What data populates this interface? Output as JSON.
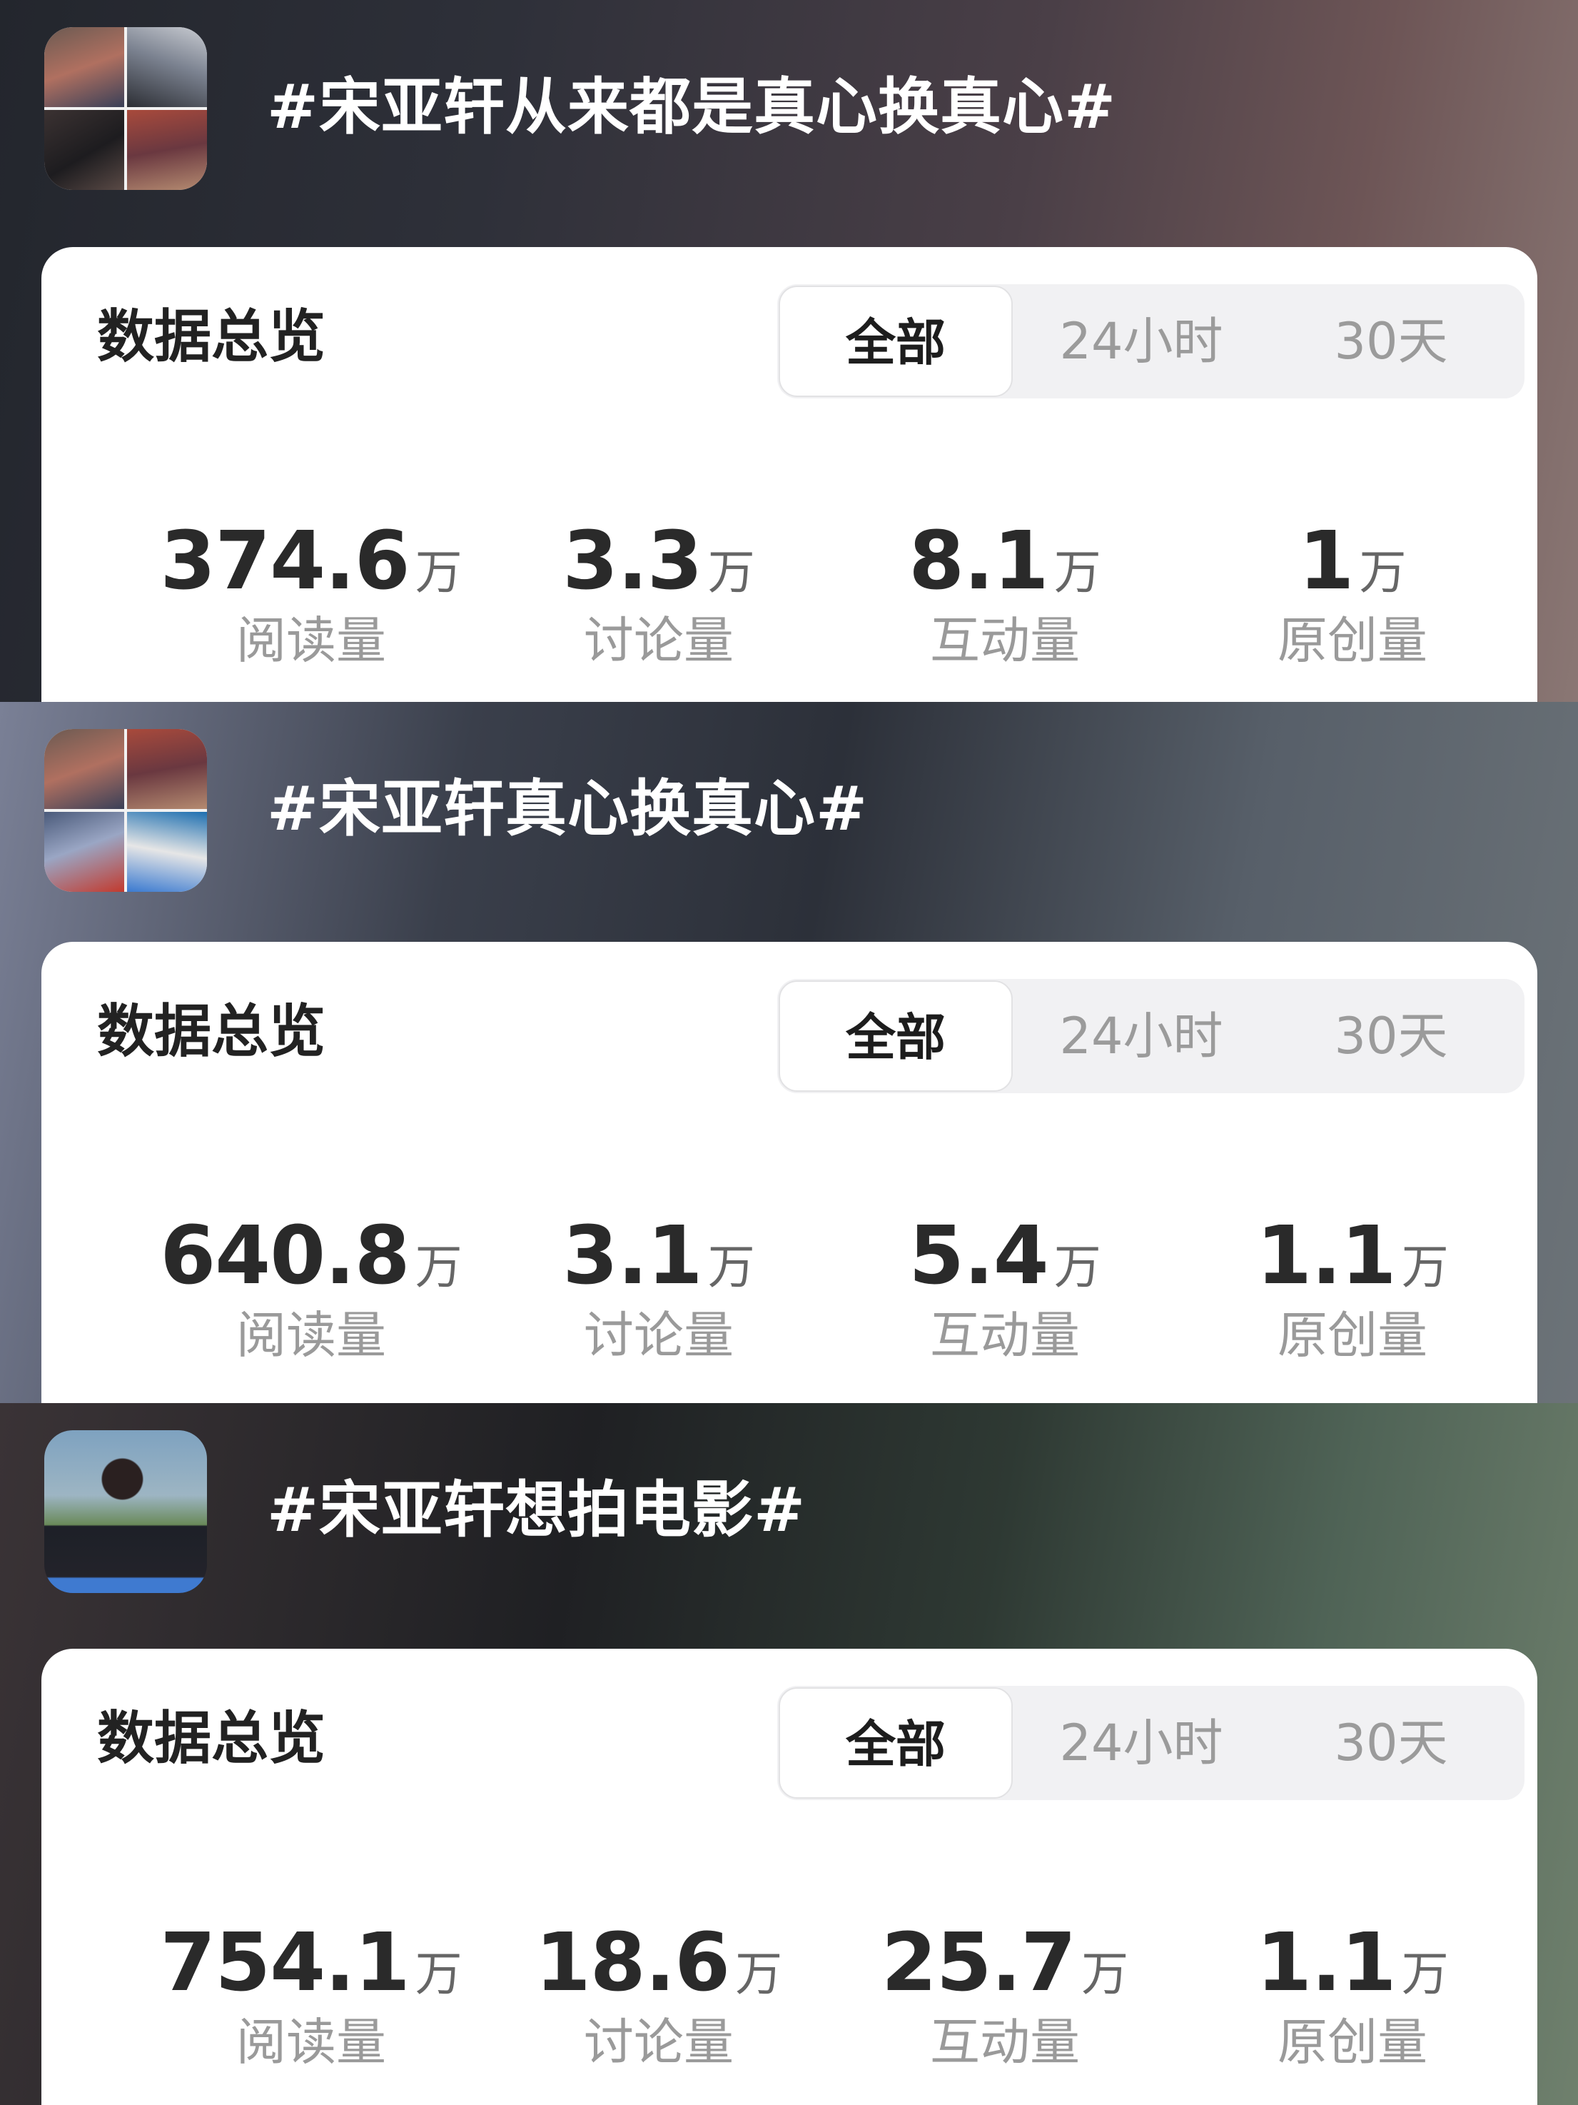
{
  "unit": "万",
  "topics": [
    {
      "title": "#宋亚轩从来都是真心换真心#",
      "card_title": "数据总览",
      "tabs": [
        "全部",
        "24小时",
        "30天"
      ],
      "stats": [
        {
          "value": "374.6",
          "label": "阅读量"
        },
        {
          "value": "3.3",
          "label": "讨论量"
        },
        {
          "value": "8.1",
          "label": "互动量"
        },
        {
          "value": "1",
          "label": "原创量"
        }
      ]
    },
    {
      "title": "#宋亚轩真心换真心#",
      "card_title": "数据总览",
      "tabs": [
        "全部",
        "24小时",
        "30天"
      ],
      "stats": [
        {
          "value": "640.8",
          "label": "阅读量"
        },
        {
          "value": "3.1",
          "label": "讨论量"
        },
        {
          "value": "5.4",
          "label": "互动量"
        },
        {
          "value": "1.1",
          "label": "原创量"
        }
      ]
    },
    {
      "title": "#宋亚轩想拍电影#",
      "card_title": "数据总览",
      "tabs": [
        "全部",
        "24小时",
        "30天"
      ],
      "stats": [
        {
          "value": "754.1",
          "label": "阅读量"
        },
        {
          "value": "18.6",
          "label": "讨论量"
        },
        {
          "value": "25.7",
          "label": "互动量"
        },
        {
          "value": "1.1",
          "label": "原创量"
        }
      ]
    }
  ],
  "active_tab_index": 0,
  "colors": {
    "card_bg": "#ffffff",
    "segment_bg": "#f1f1f3",
    "value_text": "#2a2a2a",
    "label_text": "#9a9a9a",
    "title_text": "#ffffff"
  }
}
